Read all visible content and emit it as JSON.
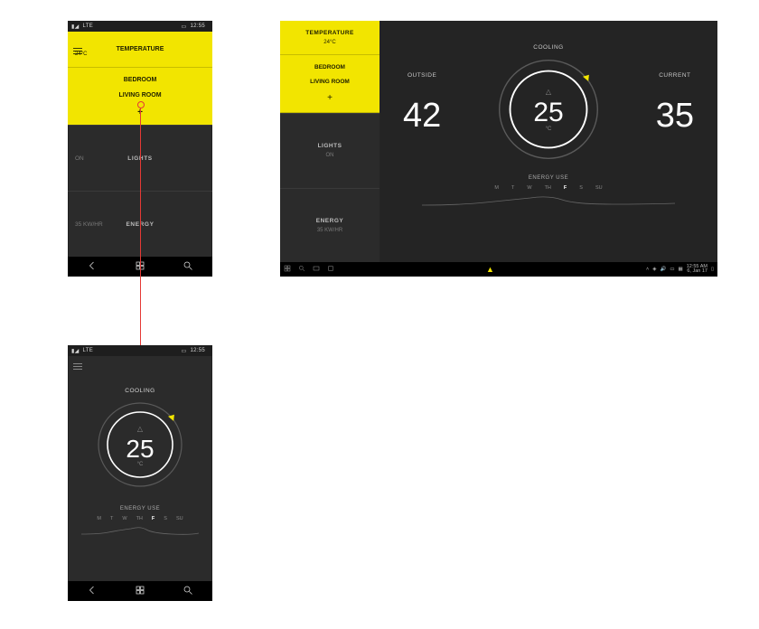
{
  "colors": {
    "accent": "#f2e500",
    "link_arrow": "#e53935"
  },
  "phone_status": {
    "carrier": "LTE",
    "time": "12:55"
  },
  "phone1": {
    "temp_label": "TEMPERATURE",
    "temp_value": "24°C",
    "rooms": {
      "bedroom": "BEDROOM",
      "living_room": "LIVING ROOM",
      "add": "+"
    },
    "lights": {
      "label": "LIGHTS",
      "value": "ON"
    },
    "energy": {
      "label": "ENERGY",
      "value": "35 KW/HR"
    }
  },
  "phone2": {
    "title": "COOLING",
    "temp": "25",
    "unit": "°C",
    "energy_title": "ENERGY USE",
    "days": [
      "M",
      "T",
      "W",
      "TH",
      "F",
      "S",
      "SU"
    ],
    "active_day_index": 4
  },
  "desktop": {
    "sidebar": {
      "temp_label": "TEMPERATURE",
      "temp_value": "24°C",
      "rooms": {
        "bedroom": "BEDROOM",
        "living_room": "LIVING ROOM",
        "add": "+"
      },
      "lights": {
        "label": "LIGHTS",
        "value": "ON"
      },
      "energy": {
        "label": "ENERGY",
        "value": "35 KW/HR"
      }
    },
    "main": {
      "outside": {
        "label": "OUTSIDE",
        "value": "42"
      },
      "cooling": {
        "label": "COOLING",
        "value": "25",
        "unit": "°C"
      },
      "current": {
        "label": "CURRENT",
        "value": "35"
      },
      "energy_title": "ENERGY USE",
      "days": [
        "M",
        "T",
        "W",
        "TH",
        "F",
        "S",
        "SU"
      ],
      "active_day_index": 4
    },
    "taskbar": {
      "time": "12:55 AM",
      "date": "6, Jan 17"
    }
  }
}
